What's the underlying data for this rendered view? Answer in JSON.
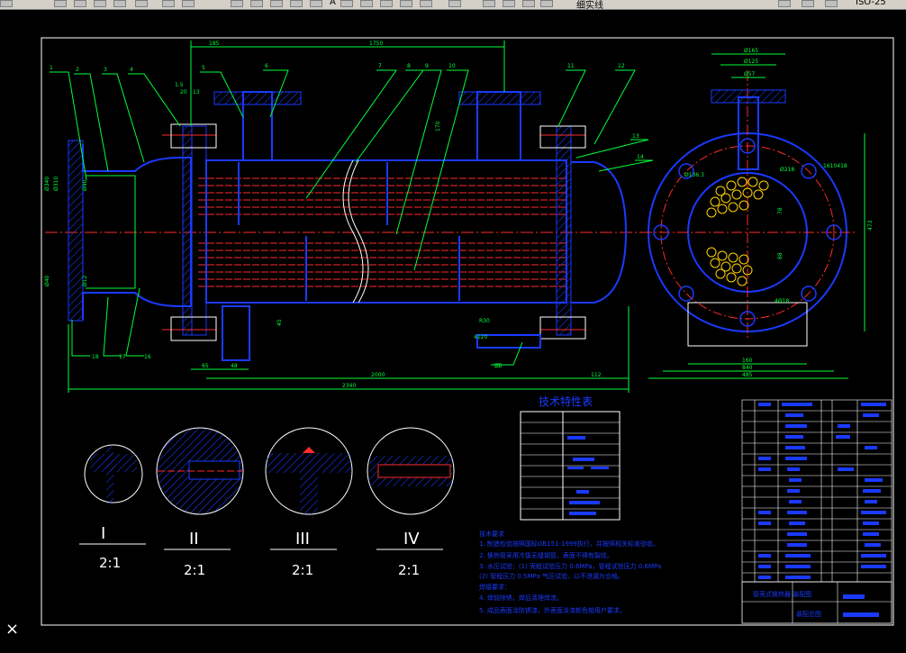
{
  "toolbar": {
    "linetype_label": "细实线",
    "letter_a": "A",
    "right_label": "ISO-25"
  },
  "drawing": {
    "dims_top": [
      "185",
      "1750"
    ],
    "dims_bottom": [
      "65",
      "48",
      "2000",
      "112",
      "2340"
    ],
    "part_numbers": [
      "1",
      "2",
      "3",
      "4",
      "5",
      "6",
      "7",
      "8",
      "9",
      "10",
      "11",
      "12",
      "13",
      "14",
      "15",
      "16",
      "17",
      "18"
    ],
    "side_dims": [
      "Ø165",
      "Ø125",
      "Ø57",
      "Ø218",
      "Ø136.3",
      "1610418",
      "473",
      "78",
      "88",
      "4Ø18",
      "160",
      "840",
      "485"
    ],
    "left_dims": [
      "Ø340",
      "Ø310",
      "Ø40",
      "Ø40",
      "Ø12"
    ],
    "small_dims": [
      "1.5",
      "20",
      "13",
      "R30",
      "4120",
      "15",
      "170",
      "45"
    ],
    "details": [
      {
        "roman": "I",
        "scale": "2:1"
      },
      {
        "roman": "II",
        "scale": "2:1"
      },
      {
        "roman": "III",
        "scale": "2:1"
      },
      {
        "roman": "IV",
        "scale": "2:1"
      }
    ],
    "tech_table_title": "技术特性表",
    "tech_req_title": "技术要求",
    "tech_req_lines": [
      "1. 制造检验按照国标GB151-1999执行，并按照相关标准验收。",
      "2. 换热管采用冷拔无缝钢管，表面不得有裂纹。",
      "3. 水压试验：(1) 壳程试验压力 0.6MPa，管程试验压力 0.6MPa",
      "          (2) 管程压力 0.5MPa 气压试验，以不泄漏为合格。",
      "焊接要求：",
      "4. 焊前除锈，焊后清理焊渣。",
      "5. 成品表面涂防锈漆，外表面涂漆颜色按用户要求。"
    ],
    "title_block": "管壳式换热器 装配图",
    "title_block_sub": "装配总图"
  }
}
